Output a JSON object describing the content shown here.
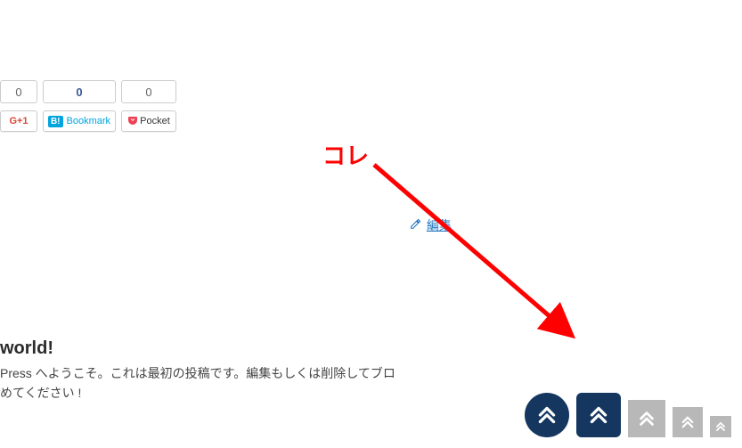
{
  "share": {
    "gplus": {
      "count": "0",
      "label": "+1"
    },
    "hatena": {
      "count": "0",
      "icon": "B!",
      "label": "Bookmark"
    },
    "pocket": {
      "count": "0",
      "label": "Pocket"
    }
  },
  "edit_link": {
    "label": "編集"
  },
  "annotation": {
    "text": "コレ"
  },
  "post": {
    "title": "world!",
    "body_line1": "Press へようこそ。これは最初の投稿です。編集もしくは削除してブロ",
    "body_line2": "めてください !"
  }
}
